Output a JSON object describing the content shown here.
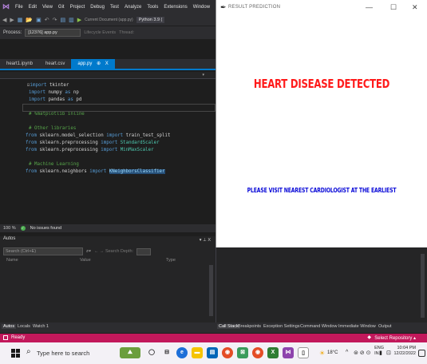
{
  "vs": {
    "menu": [
      "File",
      "Edit",
      "View",
      "Git",
      "Project",
      "Debug",
      "Test",
      "Analyze",
      "Tools",
      "Extensions",
      "Window",
      "He"
    ],
    "toolbar": {
      "target": "Current Document (app.py)",
      "python": "Python 3.9 ("
    },
    "process": {
      "label": "Process:",
      "value": "[12376] app.py",
      "lifecycle": "Lifecycle Events",
      "thread": "Thread:"
    },
    "tabs": [
      {
        "label": "heart1.ipynb",
        "active": false
      },
      {
        "label": "heart.csv",
        "active": false
      },
      {
        "label": "app.py",
        "active": true,
        "pin": "⊕",
        "close": "X"
      }
    ],
    "code": [
      {
        "parts": [
          [
            "fold",
            "⊟"
          ],
          [
            "kw",
            "import"
          ],
          [
            "",
            " tkinter"
          ]
        ]
      },
      {
        "parts": [
          [
            "kw",
            "import"
          ],
          [
            "",
            " numpy "
          ],
          [
            "kw",
            "as"
          ],
          [
            "",
            " np"
          ]
        ]
      },
      {
        "parts": [
          [
            "kw",
            "import"
          ],
          [
            "",
            " pandas "
          ],
          [
            "kw",
            "as"
          ],
          [
            "",
            " pd"
          ]
        ]
      },
      {
        "parts": [
          [
            "",
            ""
          ]
        ]
      },
      {
        "parts": [
          [
            "cm",
            "# %matplotlib inline"
          ]
        ]
      },
      {
        "parts": [
          [
            "",
            ""
          ]
        ]
      },
      {
        "parts": [
          [
            "cm",
            "# Other libraries"
          ]
        ]
      },
      {
        "parts": [
          [
            "kw",
            "from"
          ],
          [
            "",
            " sklearn.model_selection "
          ],
          [
            "kw",
            "import"
          ],
          [
            "",
            " train_test_split"
          ]
        ]
      },
      {
        "parts": [
          [
            "kw",
            "from"
          ],
          [
            "",
            " sklearn.preprocessing "
          ],
          [
            "kw",
            "import"
          ],
          [
            "cls",
            " StandardScaler"
          ]
        ]
      },
      {
        "parts": [
          [
            "kw",
            "from"
          ],
          [
            "",
            " sklearn.preprocessing "
          ],
          [
            "kw",
            "import"
          ],
          [
            "cls",
            " MinMaxScaler"
          ]
        ]
      },
      {
        "parts": [
          [
            "",
            ""
          ]
        ]
      },
      {
        "parts": [
          [
            "cm",
            "# Machine Learning"
          ]
        ]
      },
      {
        "parts": [
          [
            "kw",
            "from"
          ],
          [
            "",
            " sklearn.neighbors "
          ],
          [
            "kw",
            "import"
          ],
          [
            "",
            " "
          ],
          [
            "sel",
            "KNeighborsClassifier"
          ]
        ]
      }
    ],
    "editor_status": {
      "zoom": "100 %",
      "issues": "No issues found"
    },
    "autos": {
      "title": "Autos",
      "controls": "▾ ⊥ X",
      "search_placeholder": "Search (Ctrl+E)",
      "nav": "← → Search Depth:",
      "columns": [
        "Name",
        "Value",
        "Type"
      ]
    },
    "bottom_tabs_left": [
      "Autos",
      "Locals",
      "Watch 1"
    ],
    "bottom_tabs_right": [
      "Call Stack",
      "Breakpoints",
      "Exception Settings",
      "Command Window",
      "Immediate Window",
      "Output"
    ],
    "status": {
      "ready": "Ready",
      "repo": "Select Repository ▴"
    }
  },
  "taskbar": {
    "search": "Type here to search",
    "weather": "18°C",
    "lang": [
      "ENG",
      "IN"
    ],
    "time": "10:04 PM",
    "date": "12/22/2022"
  },
  "result_window": {
    "title": "RESULT PREDICTION",
    "heading": "HEART DISEASE DETECTED",
    "advice": "PLEASE VISIT NEAREST CARDIOLOGIST AT THE EARLIEST",
    "heading_color": "#ff1a1a",
    "advice_color": "#0b0bd8",
    "buttons": {
      "minimize": "—",
      "maximize": "☐",
      "close": "✕"
    }
  },
  "colors": {
    "ide_bg": "#1e1e1e",
    "statusbar": "#c2185b",
    "accent": "#007acc"
  }
}
